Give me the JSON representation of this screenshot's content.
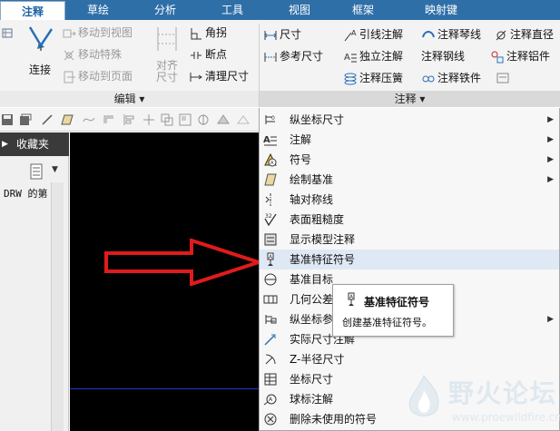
{
  "tabs": [
    {
      "label": "注释",
      "active": true
    },
    {
      "label": "草绘"
    },
    {
      "label": "分析"
    },
    {
      "label": "工具"
    },
    {
      "label": "视图"
    },
    {
      "label": "框架"
    },
    {
      "label": "映射键"
    }
  ],
  "ribbon": {
    "connect_label": "连接",
    "edit_group": {
      "footer": "编辑 ▾",
      "move_to_view": "移动到视图",
      "move_special": "移动特殊",
      "move_to_page": "移动到页面",
      "align_dim_line1": "对齐",
      "align_dim_line2": "尺寸",
      "angle": "角拐",
      "breakpoint": "断点",
      "clean_dims": "清理尺寸"
    },
    "annotation_group": {
      "footer": "注释 ▾",
      "dimension": "尺寸",
      "reference_dimension": "参考尺寸",
      "leader_note": "引线注解",
      "independent_note": "独立注解",
      "note_spring": "注释压簧",
      "note_hose": "注释琴线",
      "note_steel_wire": "注释钢线",
      "note_iron_piece": "注释铁件",
      "note_diameter": "注释直径",
      "note_component": "注释铝件"
    }
  },
  "left_panel": {
    "favorites_label": "收藏夹",
    "tree_item": "DRW 的第"
  },
  "menu": {
    "items": [
      {
        "label": "纵坐标尺寸",
        "icon": "ordinate-dim-icon",
        "submenu": true
      },
      {
        "label": "注解",
        "icon": "note-icon",
        "submenu": true
      },
      {
        "label": "符号",
        "icon": "symbol-icon",
        "submenu": true
      },
      {
        "label": "绘制基准",
        "icon": "datum-draw-icon",
        "submenu": true
      },
      {
        "label": "轴对称线",
        "icon": "symmetry-line-icon",
        "submenu": false
      },
      {
        "label": "表面粗糙度",
        "icon": "surface-finish-icon",
        "submenu": false
      },
      {
        "label": "显示模型注释",
        "icon": "show-model-annotations-icon",
        "submenu": false
      },
      {
        "label": "基准特征符号",
        "icon": "datum-feature-symbol-icon",
        "submenu": false,
        "highlighted": true
      },
      {
        "label": "基准目标",
        "icon": "datum-target-icon",
        "submenu": false
      },
      {
        "label": "几何公差",
        "icon": "geometric-tolerance-icon",
        "submenu": false
      },
      {
        "label": "纵坐标参",
        "icon": "ordinate-ref-icon",
        "submenu": true
      },
      {
        "label": "实际尺寸注解",
        "icon": "actual-dim-note-icon",
        "submenu": false
      },
      {
        "label": "Z-半径尺寸",
        "icon": "z-radius-dim-icon",
        "submenu": false
      },
      {
        "label": "坐标尺寸",
        "icon": "coordinate-dim-icon",
        "submenu": false
      },
      {
        "label": "球标注解",
        "icon": "balloon-note-icon",
        "submenu": false
      },
      {
        "label": "删除未使用的符号",
        "icon": "delete-unused-symbols-icon",
        "submenu": false
      }
    ]
  },
  "tooltip": {
    "title": "基准特征符号",
    "description": "创建基准特征符号。"
  },
  "watermark": {
    "text": "野火论坛",
    "url": "www.proewildfire.cn"
  },
  "colors": {
    "tab_bar": "#2f6fa8",
    "arrow_red": "#e01b1b",
    "canvas": "#000000",
    "blue_line": "#1d3bd6"
  }
}
